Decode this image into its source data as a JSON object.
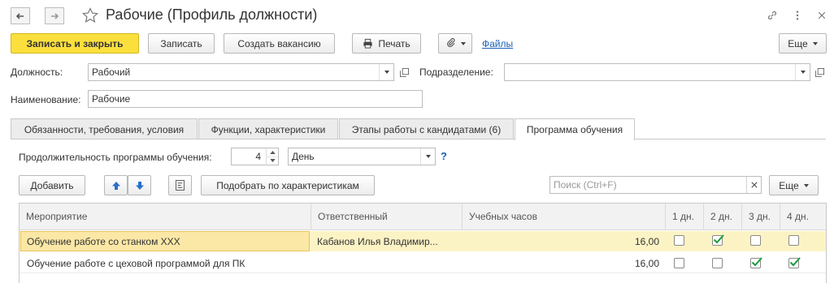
{
  "window": {
    "title": "Рабочие (Профиль должности)"
  },
  "toolbar": {
    "save_close": "Записать и закрыть",
    "save": "Записать",
    "create_vacancy": "Создать вакансию",
    "print": "Печать",
    "files": "Файлы",
    "more": "Еще"
  },
  "form": {
    "position_label": "Должность:",
    "position_value": "Рабочий",
    "department_label": "Подразделение:",
    "department_value": "",
    "name_label": "Наименование:",
    "name_value": "Рабочие"
  },
  "tabs": [
    {
      "label": "Обязанности, требования, условия"
    },
    {
      "label": "Функции, характеристики"
    },
    {
      "label": "Этапы работы с кандидатами (6)"
    },
    {
      "label": "Программа обучения"
    }
  ],
  "program": {
    "duration_label": "Продолжительность программы обучения:",
    "duration_value": "4",
    "unit_value": "День",
    "help": "?"
  },
  "table_toolbar": {
    "add": "Добавить",
    "pick": "Подобрать по характеристикам",
    "search_placeholder": "Поиск (Ctrl+F)",
    "more": "Еще"
  },
  "table": {
    "columns": [
      "Мероприятие",
      "Ответственный",
      "Учебных часов",
      "1 дн.",
      "2 дн.",
      "3 дн.",
      "4 дн."
    ],
    "rows": [
      {
        "event": "Обучение работе со станком ХХХ",
        "responsible": "Кабанов Илья Владимир...",
        "hours": "16,00",
        "days": [
          false,
          true,
          false,
          false
        ]
      },
      {
        "event": "Обучение работе с цеховой программой для ПК",
        "responsible": "",
        "hours": "16,00",
        "days": [
          false,
          false,
          true,
          true
        ]
      }
    ]
  },
  "colors": {
    "primary_button": "#fbe03d",
    "selected_row": "#fcf3c5",
    "selected_cell": "#fbe7a6",
    "check_green": "#1d9a3c",
    "link": "#1c5fb6"
  }
}
